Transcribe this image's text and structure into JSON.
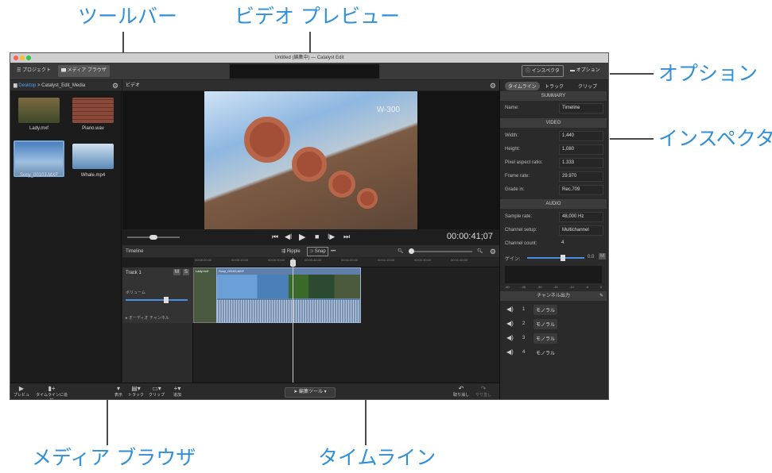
{
  "callouts": {
    "toolbar": "ツールバー",
    "preview": "ビデオ プレビュー",
    "options": "オプション",
    "inspector": "インスペクタ",
    "browser": "メディア ブラウザ",
    "timeline": "タイムライン"
  },
  "window": {
    "title": "Untitled (編集中) — Catalyst Edit"
  },
  "toolbar": {
    "project": "プロジェクト",
    "media_browser": "メディア ブラウザ",
    "inspector": "インスペクタ",
    "options": "オプション"
  },
  "browser": {
    "path_root": "Desktop",
    "path_sep": ">",
    "path_folder": "Catalyst_Edit_Media",
    "items": [
      {
        "name": "Lady.mxf"
      },
      {
        "name": "Piano.wav"
      },
      {
        "name": "Sony_00103.MXF"
      },
      {
        "name": "Whale.mp4"
      }
    ]
  },
  "video": {
    "label": "ビデオ",
    "timecode": "00:00:41;07",
    "watermark": "W-300"
  },
  "timeline": {
    "label": "Timeline",
    "ripple": "Ripple",
    "snap": "Snap",
    "more": "•••",
    "ruler": [
      "00:00:00;00",
      "00:00:15;00",
      "00:00:30;00",
      "00:00:45;00",
      "00:01:00;00",
      "00:01:15;00",
      "00:01:30;00",
      "00:01:45;00"
    ],
    "track_name": "Track 1",
    "mute": "M",
    "solo": "S",
    "volume_label": "ボリューム",
    "audio_channels": "▸ オーディオ チャンネル",
    "clip1": "Lady.mxf",
    "clip2": "Sony_00103.MXF"
  },
  "inspector": {
    "tabs": [
      "タイムライン",
      "トラック",
      "クリップ"
    ],
    "summary": "SUMMARY",
    "name_label": "Name:",
    "name_value": "Timeline",
    "video_section": "VIDEO",
    "video_rows": [
      {
        "label": "Width:",
        "value": "1,440"
      },
      {
        "label": "Height:",
        "value": "1,080"
      },
      {
        "label": "Pixel aspect ratio:",
        "value": "1.333"
      },
      {
        "label": "Frame rate:",
        "value": "29.970"
      },
      {
        "label": "Grade in:",
        "value": "Rec.709"
      }
    ],
    "audio_section": "AUDIO",
    "audio_rows": [
      {
        "label": "Sample rate:",
        "value": "48,000 Hz"
      },
      {
        "label": "Channel setup:",
        "value": "Multichannel"
      },
      {
        "label": "Channel count:",
        "value": "4"
      }
    ],
    "gain_label": "ゲイン:",
    "gain_value": "0.0",
    "gain_m": "M",
    "meter_scale": [
      "-60",
      "-45",
      "-30",
      "-20",
      "-12",
      "-6",
      "0"
    ],
    "ch_out": "チャンネル出力",
    "channels": [
      {
        "n": "1",
        "mode": "モノラル"
      },
      {
        "n": "2",
        "mode": "モノラル"
      },
      {
        "n": "3",
        "mode": "モノラル"
      },
      {
        "n": "4",
        "mode": "モノラル"
      }
    ]
  },
  "bottom": {
    "preview": "プレビュー",
    "add_to_tl": "タイムラインに追加",
    "view": "表示",
    "track": "トラック",
    "clip": "クリップ",
    "add": "追加",
    "edit_tool": "編集ツール",
    "undo": "取り消し",
    "redo": "やり直し"
  }
}
